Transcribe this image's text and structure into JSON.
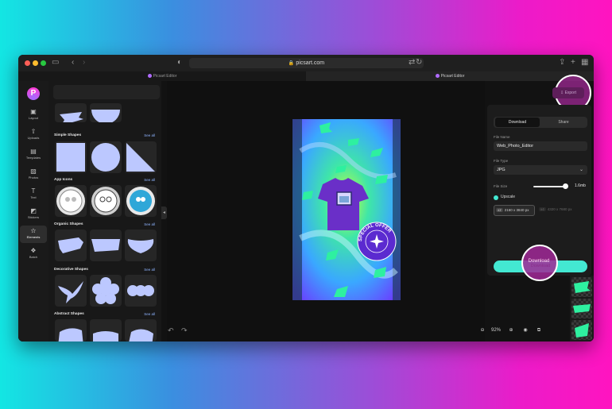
{
  "browser": {
    "url": "picsart.com",
    "tabs": [
      {
        "label": "Picsart Editor"
      },
      {
        "label": "Picsart Editor"
      }
    ]
  },
  "colors": {
    "accent": "#43e8d2",
    "export_highlight": "#a32895",
    "tile_shape": "#bcc8ff"
  },
  "rail": {
    "logo_letter": "P",
    "items": [
      {
        "label": "Layout",
        "icon": "layout-icon"
      },
      {
        "label": "Uploads",
        "icon": "upload-icon"
      },
      {
        "label": "Templates",
        "icon": "templates-icon"
      },
      {
        "label": "Photos",
        "icon": "photos-icon"
      },
      {
        "label": "Text",
        "icon": "text-icon"
      },
      {
        "label": "Stickers",
        "icon": "stickers-icon"
      },
      {
        "label": "Elements",
        "icon": "elements-icon"
      },
      {
        "label": "Batch",
        "icon": "batch-icon"
      }
    ]
  },
  "panel": {
    "sections": [
      {
        "title": "Simple Shapes",
        "see_all": "See all"
      },
      {
        "title": "App Icons",
        "see_all": "See all"
      },
      {
        "title": "Organic Shapes",
        "see_all": "See all"
      },
      {
        "title": "Decorative Shapes",
        "see_all": "See all"
      },
      {
        "title": "Abstract Shapes",
        "see_all": "See all"
      }
    ]
  },
  "canvas": {
    "badge_text": "SPECIAL OFFER"
  },
  "zoom": {
    "value": "92%"
  },
  "export": {
    "button_label": "Export",
    "tabs": [
      {
        "label": "Download"
      },
      {
        "label": "Share"
      }
    ],
    "file_name_label": "File Name",
    "file_name_value": "Web_Photo_Editor",
    "file_type_label": "File Type",
    "file_type_value": "JPG",
    "file_size_label": "File Size",
    "file_size_value": "1.6mb",
    "upscale_label": "Upscale",
    "resolutions": [
      {
        "badge": "x2",
        "value": "2160 x 3840 px"
      },
      {
        "badge": "x4",
        "value": "4320 x 7680 px"
      }
    ],
    "download_label": "Download"
  }
}
